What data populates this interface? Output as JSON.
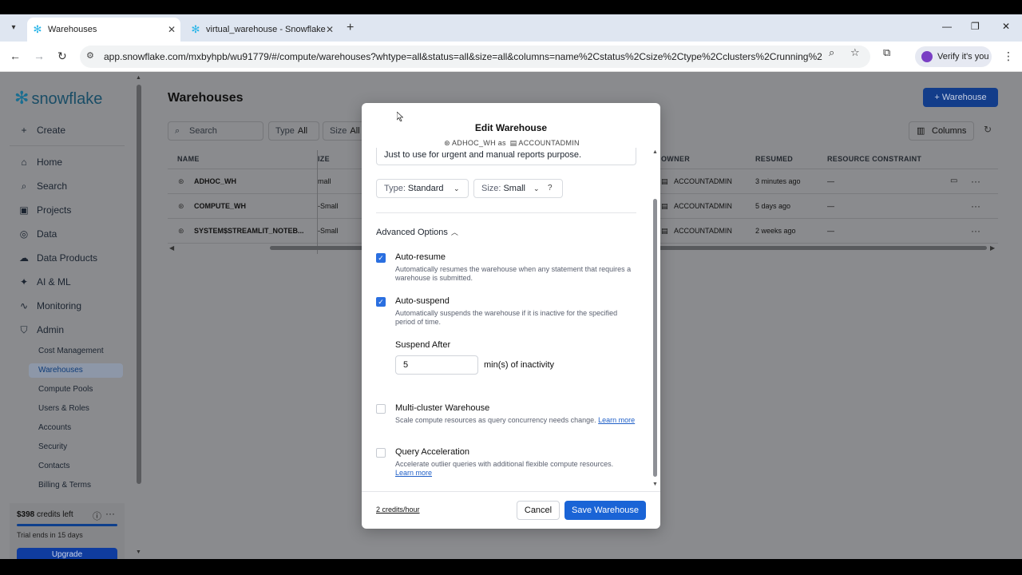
{
  "browser": {
    "tabs": [
      {
        "label": "Warehouses",
        "active": true
      },
      {
        "label": "virtual_warehouse - Snowflake",
        "active": false
      }
    ],
    "url": "app.snowflake.com/mxbyhpb/wu91779/#/compute/warehouses?whtype=all&status=all&size=all&columns=name%2Cstatus%2Csize%2Ctype%2Cclusters%2Crunning%2Cq...",
    "verify_label": "Verify it's you"
  },
  "sidebar": {
    "logo": "snowflake",
    "create_label": "Create",
    "items": [
      {
        "label": "Home",
        "icon": "home-icon"
      },
      {
        "label": "Search",
        "icon": "search-icon"
      },
      {
        "label": "Projects",
        "icon": "projects-icon"
      },
      {
        "label": "Data",
        "icon": "database-icon"
      },
      {
        "label": "Data Products",
        "icon": "cloud-icon"
      },
      {
        "label": "AI & ML",
        "icon": "sparkle-icon"
      },
      {
        "label": "Monitoring",
        "icon": "activity-icon"
      },
      {
        "label": "Admin",
        "icon": "shield-icon"
      }
    ],
    "admin_items": [
      "Cost Management",
      "Warehouses",
      "Compute Pools",
      "Users & Roles",
      "Accounts",
      "Security",
      "Contacts",
      "Billing & Terms"
    ],
    "credits": {
      "amount": "$398",
      "suffix": "credits left",
      "trial": "Trial ends in 15 days",
      "upgrade": "Upgrade"
    }
  },
  "main": {
    "title": "Warehouses",
    "add_button": "Warehouse",
    "search_placeholder": "Search",
    "filters": [
      {
        "label": "Type",
        "value": "All"
      },
      {
        "label": "Size",
        "value": "All"
      }
    ],
    "columns_button": "Columns",
    "table": {
      "headers": [
        "NAME",
        "IZE",
        "OWNER",
        "RESUMED",
        "RESOURCE CONSTRAINT"
      ],
      "rows": [
        {
          "name": "ADHOC_WH",
          "size": "mall",
          "owner": "ACCOUNTADMIN",
          "resumed": "3 minutes ago",
          "constraint": "—"
        },
        {
          "name": "COMPUTE_WH",
          "size": "-Small",
          "owner": "ACCOUNTADMIN",
          "resumed": "5 days ago",
          "constraint": "—"
        },
        {
          "name": "SYSTEM$STREAMLIT_NOTEB...",
          "size": "-Small",
          "owner": "ACCOUNTADMIN",
          "resumed": "2 weeks ago",
          "constraint": "—"
        }
      ]
    }
  },
  "modal": {
    "title": "Edit Warehouse",
    "warehouse": "ADHOC_WH",
    "as_label": "as",
    "role": "ACCOUNTADMIN",
    "comment": "Just to use for urgent and manual reports purpose.",
    "type_label": "Type:",
    "type_value": "Standard",
    "size_label": "Size:",
    "size_value": "Small",
    "advanced_label": "Advanced Options",
    "options": [
      {
        "title": "Auto-resume",
        "desc": "Automatically resumes the warehouse when any statement that requires a warehouse is submitted.",
        "checked": true
      },
      {
        "title": "Auto-suspend",
        "desc": "Automatically suspends the warehouse if it is inactive for the specified period of time.",
        "checked": true
      },
      {
        "title": "Multi-cluster Warehouse",
        "desc": "Scale compute resources as query concurrency needs change.",
        "link": "Learn more",
        "checked": false
      },
      {
        "title": "Query Acceleration",
        "desc": "Accelerate outlier queries with additional flexible compute resources.",
        "link": "Learn more",
        "checked": false
      }
    ],
    "suspend_after_label": "Suspend After",
    "suspend_after_value": "5",
    "suspend_unit": "min(s) of inactivity",
    "credits_link": "2 credits/hour",
    "cancel": "Cancel",
    "save": "Save Warehouse"
  }
}
